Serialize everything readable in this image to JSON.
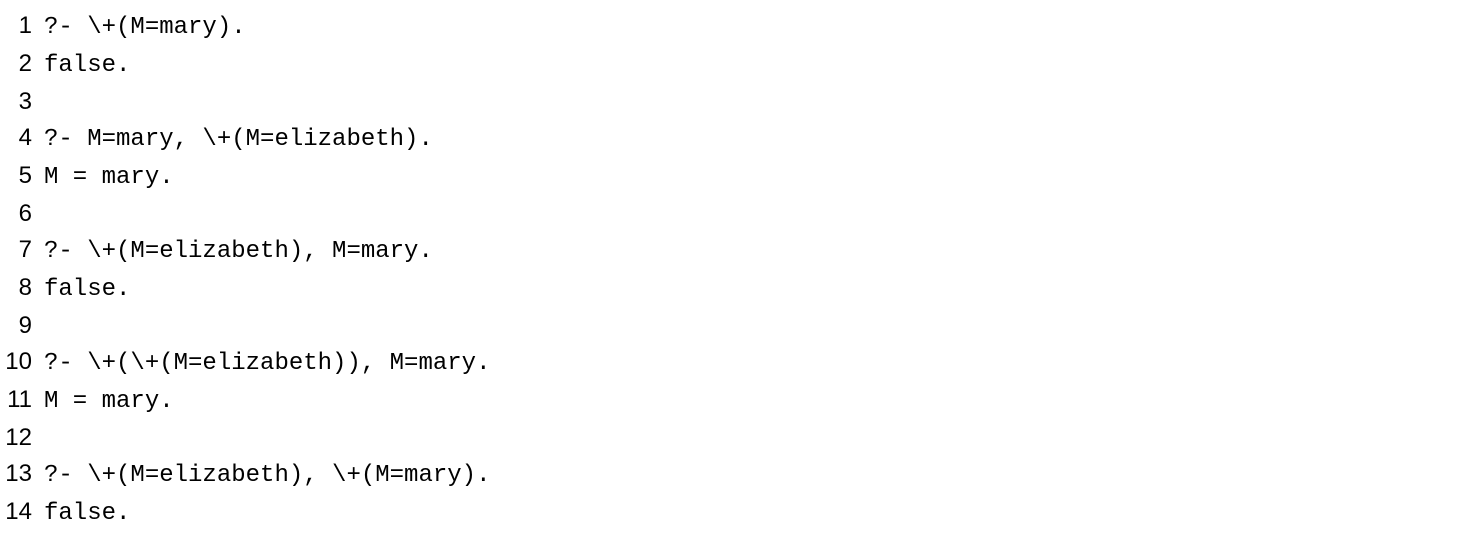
{
  "lines": [
    {
      "n": "1",
      "t": "?- \\+(M=mary)."
    },
    {
      "n": "2",
      "t": "false."
    },
    {
      "n": "3",
      "t": ""
    },
    {
      "n": "4",
      "t": "?- M=mary, \\+(M=elizabeth)."
    },
    {
      "n": "5",
      "t": "M = mary."
    },
    {
      "n": "6",
      "t": ""
    },
    {
      "n": "7",
      "t": "?- \\+(M=elizabeth), M=mary."
    },
    {
      "n": "8",
      "t": "false."
    },
    {
      "n": "9",
      "t": ""
    },
    {
      "n": "10",
      "t": "?- \\+(\\+(M=elizabeth)), M=mary."
    },
    {
      "n": "11",
      "t": "M = mary."
    },
    {
      "n": "12",
      "t": ""
    },
    {
      "n": "13",
      "t": "?- \\+(M=elizabeth), \\+(M=mary)."
    },
    {
      "n": "14",
      "t": "false."
    }
  ]
}
